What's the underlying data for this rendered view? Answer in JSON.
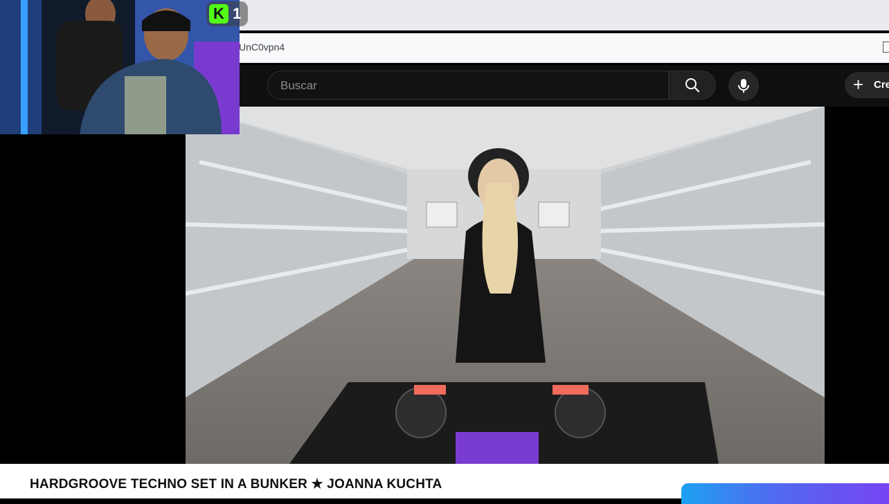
{
  "browser": {
    "url_text": "UnC0vpn4"
  },
  "youtube": {
    "search_placeholder": "Buscar",
    "create_label": "Cre",
    "icons": {
      "search": "search-icon",
      "mic": "mic-icon",
      "create": "plus-icon"
    }
  },
  "overlay": {
    "kick_logo": "K",
    "viewer_count": "1"
  },
  "video": {
    "title": "HARDGROOVE TECHNO SET IN A BUNKER ★ JOANNA KUCHTA"
  },
  "colors": {
    "kick_green": "#53fc18",
    "header_bg": "#0f0f0f",
    "page_bg": "#ffffff"
  }
}
